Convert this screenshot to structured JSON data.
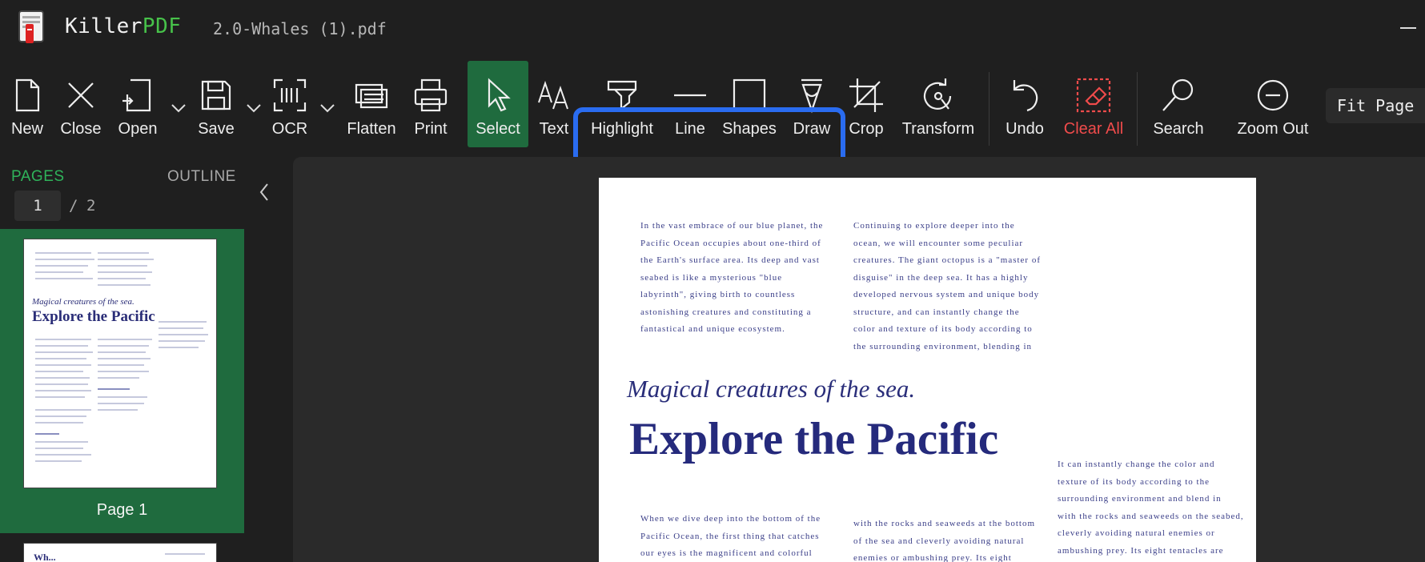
{
  "app": {
    "name_part1": "Killer",
    "name_part2": "PDF",
    "document_title": "2.0-Whales (1).pdf"
  },
  "toolbar": {
    "new": "New",
    "close": "Close",
    "open": "Open",
    "save": "Save",
    "ocr": "OCR",
    "flatten": "Flatten",
    "print": "Print",
    "select": "Select",
    "text": "Text",
    "highlight": "Highlight",
    "line": "Line",
    "shapes": "Shapes",
    "draw": "Draw",
    "crop": "Crop",
    "transform": "Transform",
    "undo": "Undo",
    "clear_all": "Clear All",
    "search": "Search",
    "zoom_out": "Zoom Out",
    "fit_page": "Fit Page",
    "active_tool": "Select"
  },
  "colors": {
    "accent_green": "#2fb35a",
    "active_bg": "#1f6b3e",
    "danger": "#ef4b4b",
    "highlight_frame": "#2a6cf0",
    "pdf_text": "#2a2e7a"
  },
  "sidebar": {
    "tab_pages": "PAGES",
    "tab_outline": "OUTLINE",
    "current_page": "1",
    "separator": "/",
    "total_pages": "2",
    "thumbnails": [
      {
        "label": "Page 1",
        "subtitle": "Magical creatures of the sea.",
        "heading": "Explore the Pacific"
      },
      {
        "label": "",
        "heading": "Wh..."
      }
    ]
  },
  "pdf": {
    "col1_top": [
      "In the vast embrace of our blue planet, the",
      "Pacific Ocean occupies about one-third of",
      "the Earth's surface area. Its deep and vast",
      "seabed is like a mysterious \"blue",
      "labyrinth\", giving birth to countless",
      "astonishing creatures and constituting a",
      "fantastical and unique ecosystem."
    ],
    "col2_top": [
      "Continuing to explore deeper into the",
      "ocean, we will encounter some peculiar",
      "creatures. The giant octopus is a \"master of",
      "disguise\" in the deep sea. It has a highly",
      "developed nervous system and unique body",
      "structure, and can instantly change the",
      "color and texture of its body according to",
      "the surrounding environment, blending in"
    ],
    "subtitle": "Magical creatures of the sea.",
    "heading": "Explore the Pacific",
    "col3_right": [
      "It can instantly change the color and",
      "texture of its body according to the",
      "surrounding environment and blend in",
      "with the rocks and seaweeds on the seabed,",
      "cleverly avoiding natural enemies or",
      "ambushing prey. Its eight tentacles are"
    ],
    "col1_bottom": [
      "When we dive deep into the bottom of the",
      "Pacific Ocean, the first thing that catches",
      "our eyes is the magnificent and colorful"
    ],
    "col2_bottom": [
      "with the rocks and seaweeds at the bottom",
      "of the sea and cleverly avoiding natural",
      "enemies or ambushing prey. Its eight"
    ]
  }
}
